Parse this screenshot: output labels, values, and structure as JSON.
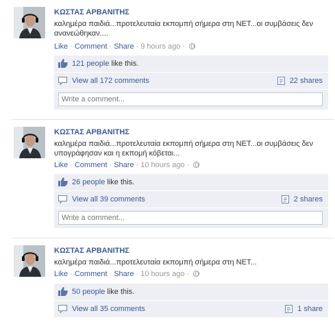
{
  "posts": [
    {
      "author": "ΚΩΣΤΑΣ ΑΡΒΑΝΙΤΗΣ",
      "message": "καλημέρα παιδιά...προτελευταία εκπομπή σήμερα στη ΝΕΤ...οι συμβάσεις δεν ανανεώθηκαν....",
      "actions": {
        "like": "Like",
        "comment": "Comment",
        "share": "Share",
        "time": "9 hours ago"
      },
      "likes": {
        "people": "121 people",
        "suffix": " like this."
      },
      "view_comments": "View all 172 comments",
      "shares": "22 shares",
      "comment_placeholder": "Write a comment..."
    },
    {
      "author": "ΚΩΣΤΑΣ ΑΡΒΑΝΙΤΗΣ",
      "message": "καλημέρα παιδιά...προτελευταία εκπομπή σήμερα στη ΝΕΤ...οι συμβάσεις δεν υπογράφησαν και η εκπομή κόβεται...",
      "actions": {
        "like": "Like",
        "comment": "Comment",
        "share": "Share",
        "time": "10 hours ago"
      },
      "likes": {
        "people": "26 people",
        "suffix": " like this."
      },
      "view_comments": "View all 39 comments",
      "shares": "2 shares",
      "comment_placeholder": "Write a comment..."
    },
    {
      "author": "ΚΩΣΤΑΣ ΑΡΒΑΝΙΤΗΣ",
      "message": "καλημέρα παιδιά...προτελευταία εκπομπή σήμερα στη ΝΕΤ...",
      "actions": {
        "like": "Like",
        "comment": "Comment",
        "share": "Share",
        "time": "10 hours ago"
      },
      "likes": {
        "people": "50 people",
        "suffix": " like this."
      },
      "view_comments": "View all 35 comments",
      "shares": "1 share"
    }
  ],
  "colors": {
    "link": "#3b5998",
    "ufi_bg": "#edeff4",
    "border": "#bdc7d8"
  },
  "icons": [
    "thumbs-up-icon",
    "comments-icon",
    "shares-icon",
    "globe-icon"
  ]
}
